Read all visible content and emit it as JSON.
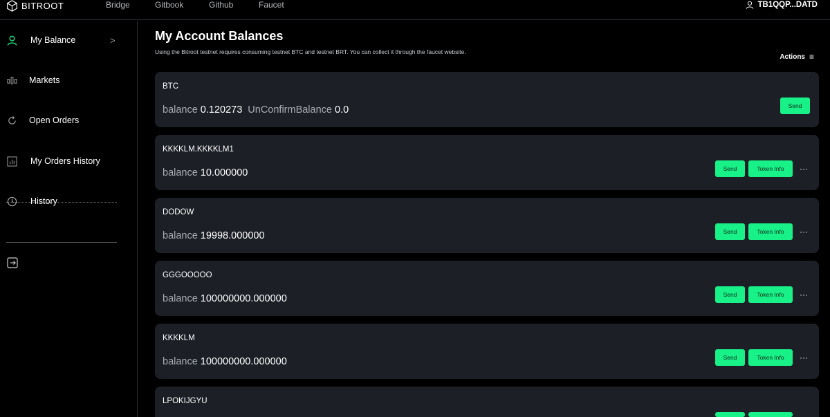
{
  "app": {
    "logo_text": "BITROOT"
  },
  "nav": {
    "items": [
      "Bridge",
      "Gitbook",
      "Github",
      "Faucet"
    ]
  },
  "account": {
    "address": "TB1QQP...DATD"
  },
  "sidebar": {
    "items": [
      {
        "label": "My Balance",
        "icon": "user-icon",
        "chevron": ">"
      },
      {
        "label": "Markets",
        "icon": "markets-icon"
      },
      {
        "label": "Open Orders",
        "icon": "refresh-icon"
      },
      {
        "label": "My Orders History",
        "icon": "chart-icon"
      },
      {
        "label": "History",
        "icon": "clock-icon"
      }
    ],
    "exit_icon": "exit-icon"
  },
  "main": {
    "title": "My Account Balances",
    "subtitle": "Using the Bitroot testnet requires consuming testnet BTC and testnet BRT. You can collect it through the faucet website.",
    "actions_label": "Actions",
    "balance_label": "balance",
    "unconfirm_label": "UnConfirmBalance",
    "send_label": "Send",
    "token_info_label": "Token Info",
    "more_label": "···",
    "tokens": [
      {
        "name": "BTC",
        "balance": "0.120273",
        "unconfirm": "0.0"
      },
      {
        "name": "KKKKLM.KKKKLM1",
        "balance": "10.000000"
      },
      {
        "name": "DODOW",
        "balance": "19998.000000"
      },
      {
        "name": "GGGOOOOO",
        "balance": "100000000.000000"
      },
      {
        "name": "KKKKLM",
        "balance": "100000000.000000"
      },
      {
        "name": "LPOKIJGYU",
        "balance": ""
      }
    ]
  },
  "colors": {
    "accent": "#18f187",
    "card": "#1c2026",
    "background": "#000000"
  }
}
